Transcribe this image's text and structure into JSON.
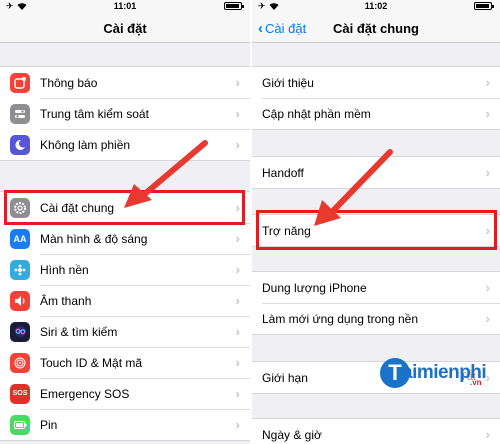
{
  "left": {
    "status": {
      "time": "11:01"
    },
    "nav": {
      "title": "Cài đặt"
    },
    "groups": [
      [
        {
          "label": "Thông báo",
          "icon": "notifications-icon",
          "color": "#f5413a"
        },
        {
          "label": "Trung tâm kiểm soát",
          "icon": "control-center-icon",
          "color": "#8e8e93"
        },
        {
          "label": "Không làm phiền",
          "icon": "do-not-disturb-icon",
          "color": "#5856d6"
        }
      ],
      [
        {
          "label": "Cài đặt chung",
          "icon": "gear-icon",
          "color": "#8e8e93"
        },
        {
          "label": "Màn hình & độ sáng",
          "icon": "display-brightness-icon",
          "color": "#1a7cf0"
        },
        {
          "label": "Hình nền",
          "icon": "wallpaper-icon",
          "color": "#35aadc"
        },
        {
          "label": "Âm thanh",
          "icon": "sounds-icon",
          "color": "#f5413a"
        },
        {
          "label": "Siri & tìm kiếm",
          "icon": "siri-icon",
          "color": "#1c1c3a"
        },
        {
          "label": "Touch ID & Mật mã",
          "icon": "touch-id-icon",
          "color": "#f5413a"
        },
        {
          "label": "Emergency SOS",
          "icon": "sos-icon",
          "color": "#e0302a"
        },
        {
          "label": "Pin",
          "icon": "battery-icon",
          "color": "#4cd964"
        }
      ]
    ]
  },
  "right": {
    "status": {
      "time": "11:02"
    },
    "nav": {
      "title": "Cài đặt chung",
      "back": "Cài đặt"
    },
    "groups": [
      [
        {
          "label": "Giới thiệu"
        },
        {
          "label": "Cập nhật phần mềm"
        }
      ],
      [
        {
          "label": "Handoff"
        }
      ],
      [
        {
          "label": "Trợ năng"
        }
      ],
      [
        {
          "label": "Dung lượng iPhone"
        },
        {
          "label": "Làm mới ứng dụng trong nền"
        }
      ],
      [
        {
          "label": "Giới hạn",
          "value": "Tắt"
        }
      ],
      [
        {
          "label": "Ngày & giờ"
        }
      ]
    ]
  },
  "watermark": {
    "letter": "T",
    "text": "aimienphi",
    "suffix": ".vn"
  },
  "colors": {
    "accent": "#007aff",
    "highlight": "#e31b23"
  }
}
